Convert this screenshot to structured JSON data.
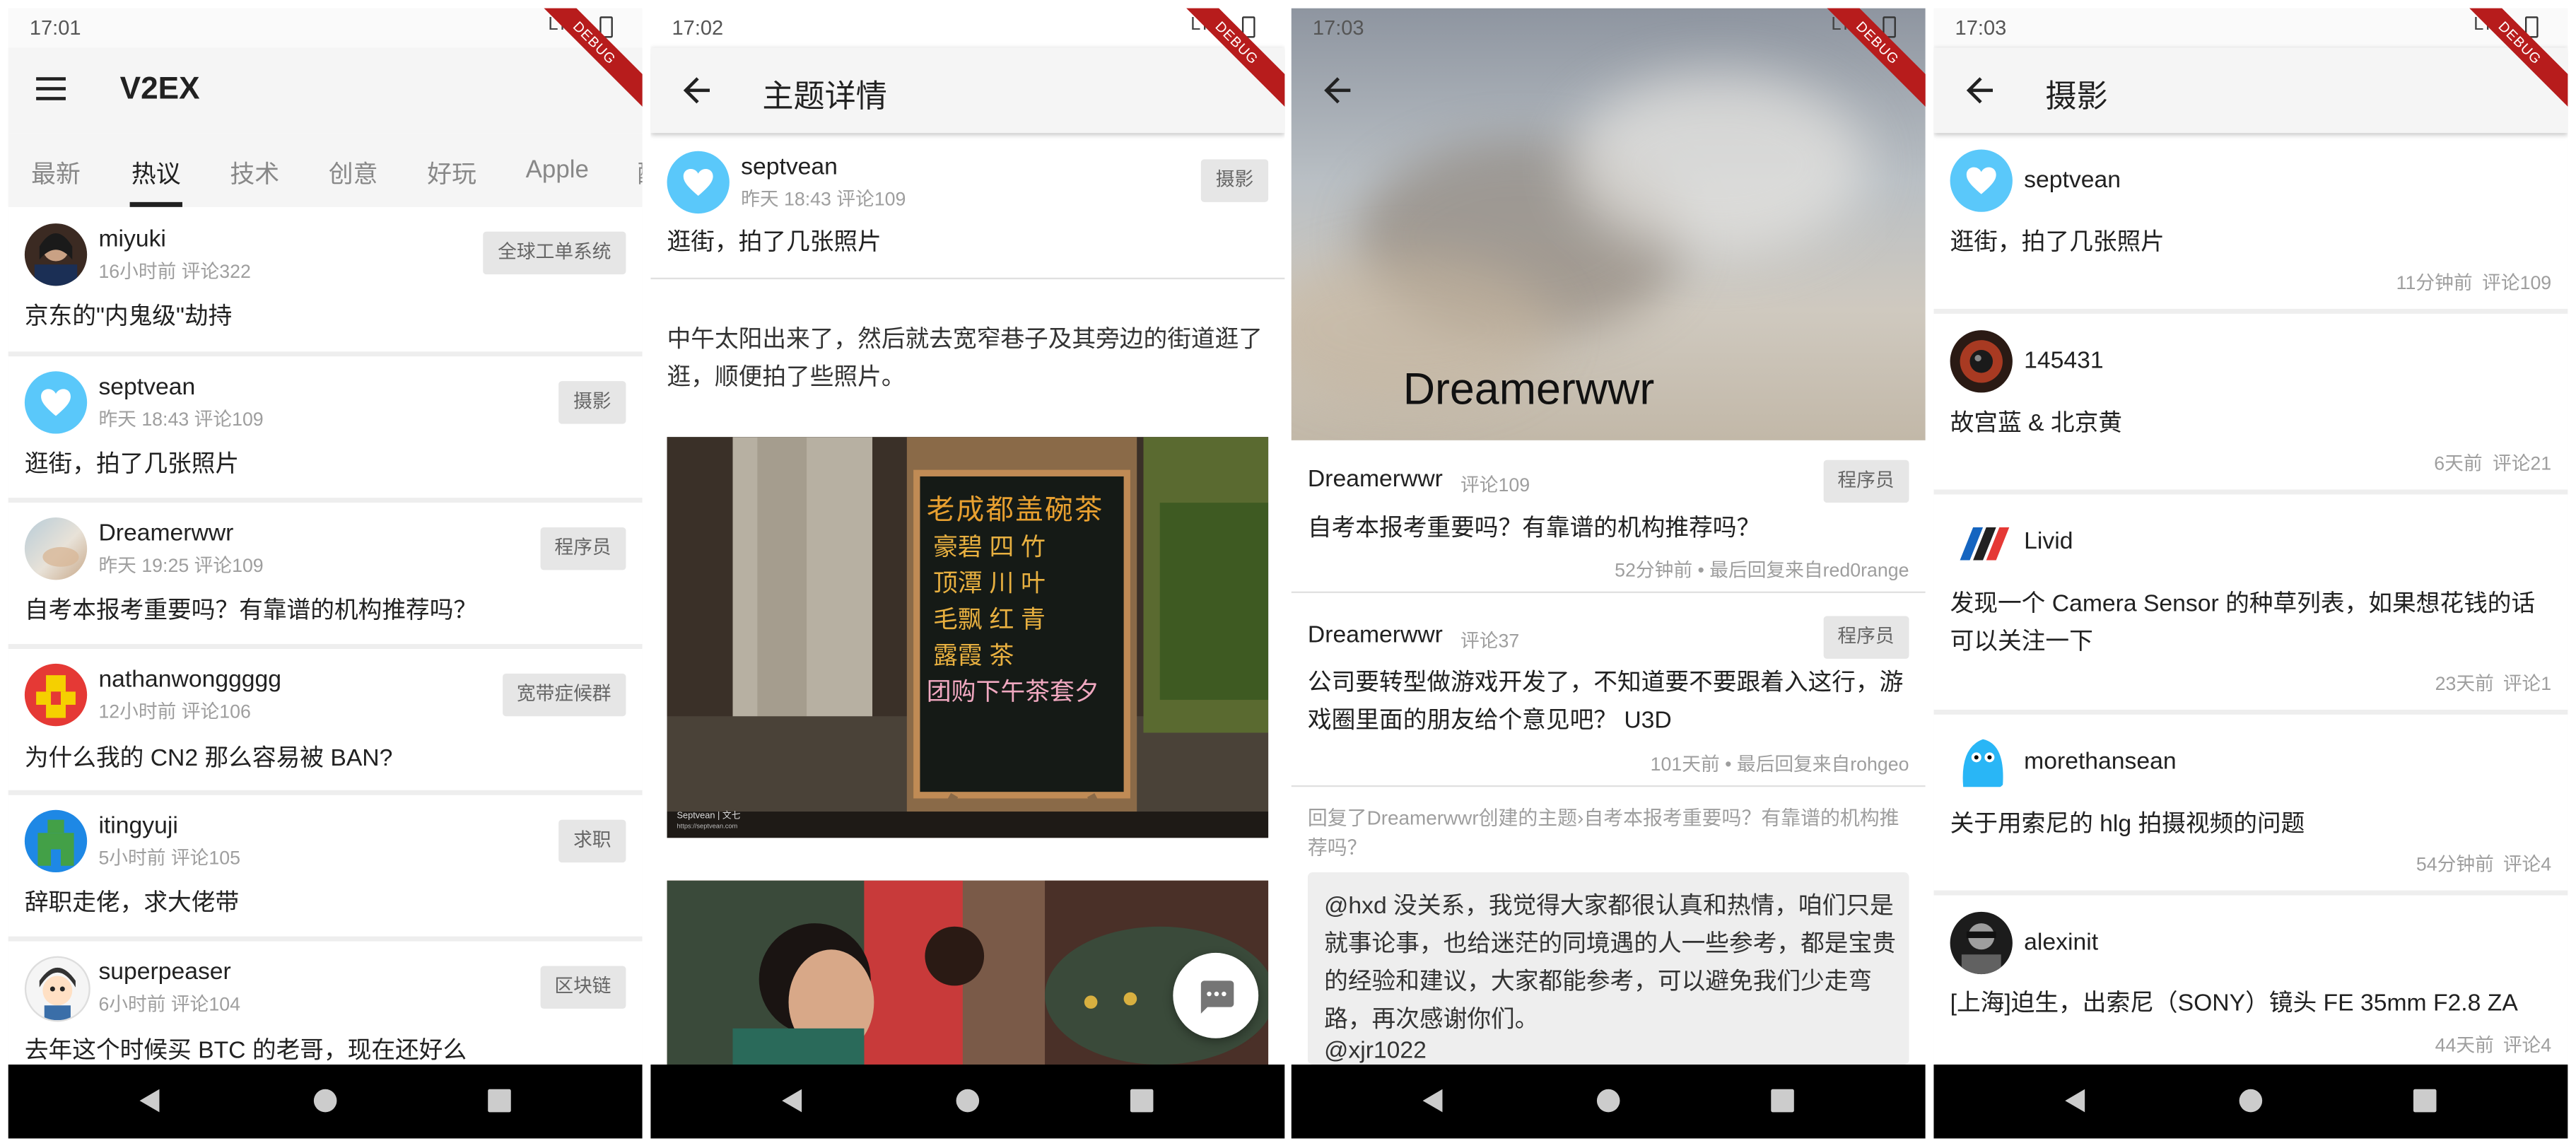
{
  "colors": {
    "debug_ribbon": "#b71c1c",
    "appbar_bg": "#f5f5f5",
    "node_bg": "#e6e6e6",
    "nav_bar": "#000000",
    "heart_avatar_bg": "#5ac8fa"
  },
  "screen1": {
    "status_time": "17:01",
    "status_network": "LTE",
    "debug_label": "DEBUG",
    "menu_icon": "hamburger-menu-icon",
    "title": "V2EX",
    "tabs": [
      "最新",
      "热议",
      "技术",
      "创意",
      "好玩",
      "Apple",
      "酷"
    ],
    "active_tab": "热议",
    "topics": [
      {
        "user": "miyuki",
        "meta": "16小时前 评论322",
        "node": "全球工单系统",
        "title": "京东的\"内鬼级\"劫持"
      },
      {
        "user": "septvean",
        "meta": "昨天 18:43 评论109",
        "node": "摄影",
        "title": "逛街，拍了几张照片"
      },
      {
        "user": "Dreamerwwr",
        "meta": "昨天 19:25 评论109",
        "node": "程序员",
        "title": "自考本报考重要吗？有靠谱的机构推荐吗？"
      },
      {
        "user": "nathanwonggggg",
        "meta": "12小时前 评论106",
        "node": "宽带症候群",
        "title": "为什么我的 CN2 那么容易被 BAN?"
      },
      {
        "user": "itingyuji",
        "meta": "5小时前 评论105",
        "node": "求职",
        "title": "辞职走佬，求大佬带"
      },
      {
        "user": "superpeaser",
        "meta": "6小时前 评论104",
        "node": "区块链",
        "title": "去年这个时候买 BTC 的老哥，现在还好么"
      }
    ]
  },
  "screen2": {
    "status_time": "17:02",
    "status_network": "LTE",
    "debug_label": "DEBUG",
    "title": "主题详情",
    "author": "septvean",
    "meta": "昨天 18:43 评论109",
    "node": "摄影",
    "topic_title": "逛街，拍了几张照片",
    "content": "中午太阳出来了，然后就去宽窄巷子及其旁边的街道逛了逛，顺便拍了些照片。",
    "photo1_watermark": "Septvean | 文七",
    "photo1_watermark_url": "https://septvean.com",
    "board_lines": [
      "老成都盖碗茶",
      "豪碧 四 竹",
      "顶潭 川 叶",
      "毛飘 红 青",
      "露霞 茶",
      "团购下午茶套夕"
    ],
    "fab_icon": "comment-icon"
  },
  "screen3": {
    "status_time": "17:03",
    "status_network": "LTE",
    "debug_label": "DEBUG",
    "header_name": "Dreamerwwr",
    "topics": [
      {
        "user": "Dreamerwwr",
        "count": "评论109",
        "node": "程序员",
        "title": "自考本报考重要吗？有靠谱的机构推荐吗？",
        "footer": "52分钟前 • 最后回复来自red0range"
      },
      {
        "user": "Dreamerwwr",
        "count": "评论37",
        "node": "程序员",
        "title": "公司要转型做游戏开发了，不知道要不要跟着入这行，游戏圈里面的朋友给个意见吧？ U3D",
        "footer": "101天前 • 最后回复来自rohgeo"
      }
    ],
    "reply_header": "回复了Dreamerwwr创建的主题›自考本报考重要吗？有靠谱的机构推荐吗？",
    "reply_body": "@hxd 没关系，我觉得大家都很认真和热情，咱们只是就事论事，也给迷茫的同境遇的人一些参考，都是宝贵的经验和建议，大家都能参考，可以避免我们少走弯路，再次感谢你们。",
    "reply_mention": "@xjr1022"
  },
  "screen4": {
    "status_time": "17:03",
    "status_network": "LTE",
    "debug_label": "DEBUG",
    "title": "摄影",
    "topics": [
      {
        "user": "septvean",
        "title": "逛街，拍了几张照片",
        "time": "11分钟前",
        "count": "评论109"
      },
      {
        "user": "145431",
        "title": "故宫蓝 & 北京黄",
        "time": "6天前",
        "count": "评论21"
      },
      {
        "user": "Livid",
        "title": "发现一个 Camera Sensor 的种草列表，如果想花钱的话可以关注一下",
        "time": "23天前",
        "count": "评论1"
      },
      {
        "user": "morethansean",
        "title": "关于用索尼的 hlg 拍摄视频的问题",
        "time": "54分钟前",
        "count": "评论4"
      },
      {
        "user": "alexinit",
        "title": "[上海]迫生，出索尼（SONY）镜头 FE 35mm F2.8 ZA",
        "time": "44天前",
        "count": "评论4"
      }
    ]
  }
}
